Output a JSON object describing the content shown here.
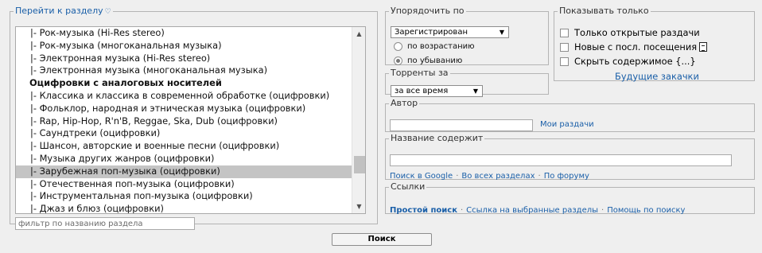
{
  "sections": {
    "legend": "Перейти к разделу",
    "legend_icon": "heart-outline-icon",
    "items": [
      {
        "label": "|- Рок-музыка (Hi-Res stereo)",
        "group": false,
        "selected": false
      },
      {
        "label": "|- Рок-музыка (многоканальная музыка)",
        "group": false,
        "selected": false
      },
      {
        "label": "|- Электронная музыка (Hi-Res stereo)",
        "group": false,
        "selected": false
      },
      {
        "label": "|- Электронная музыка (многоканальная музыка)",
        "group": false,
        "selected": false
      },
      {
        "label": "Оцифровки с аналоговых носителей",
        "group": true,
        "selected": false
      },
      {
        "label": "|- Классика и классика в современной обработке (оцифровки)",
        "group": false,
        "selected": false
      },
      {
        "label": "|- Фольклор, народная и этническая музыка (оцифровки)",
        "group": false,
        "selected": false
      },
      {
        "label": "|- Rap, Hip-Hop, R'n'B, Reggae, Ska, Dub (оцифровки)",
        "group": false,
        "selected": false
      },
      {
        "label": "|- Саундтреки (оцифровки)",
        "group": false,
        "selected": false
      },
      {
        "label": "|- Шансон, авторские и военные песни (оцифровки)",
        "group": false,
        "selected": false
      },
      {
        "label": "|- Музыка других жанров (оцифровки)",
        "group": false,
        "selected": false
      },
      {
        "label": "|- Зарубежная поп-музыка (оцифровки)",
        "group": false,
        "selected": true
      },
      {
        "label": "|- Отечественная поп-музыка (оцифровки)",
        "group": false,
        "selected": false
      },
      {
        "label": "|- Инструментальная поп-музыка (оцифровки)",
        "group": false,
        "selected": false
      },
      {
        "label": "|- Джаз и блюз (оцифровки)",
        "group": false,
        "selected": false
      }
    ],
    "filter_placeholder": "фильтр по названию раздела"
  },
  "sort": {
    "legend": "Упорядочить по",
    "selected": "Зарегистрирован",
    "asc_label": "по возрастанию",
    "desc_label": "по убыванию",
    "order": "desc"
  },
  "period": {
    "legend": "Торренты за",
    "selected": "за все время"
  },
  "show_only": {
    "legend": "Показывать только",
    "open_label": "Только открытые раздачи",
    "new_label": "Новые с посл. посещения",
    "new_icon": "document-icon",
    "hide_label": "Скрыть содержимое {...}",
    "future_link": "Будущие закачки"
  },
  "author": {
    "legend": "Автор",
    "value": "",
    "my_releases": "Мои раздачи"
  },
  "title_contains": {
    "legend": "Название содержит",
    "value": "",
    "google": "Поиск в Google",
    "all_sections": "Во всех разделах",
    "forum": "По форуму",
    "separator": "·"
  },
  "links": {
    "legend": "Ссылки",
    "simple_search": "Простой поиск",
    "selected_sections": "Ссылка на выбранные разделы",
    "help": "Помощь по поиску",
    "separator": "·"
  },
  "submit_label": "Поиск"
}
